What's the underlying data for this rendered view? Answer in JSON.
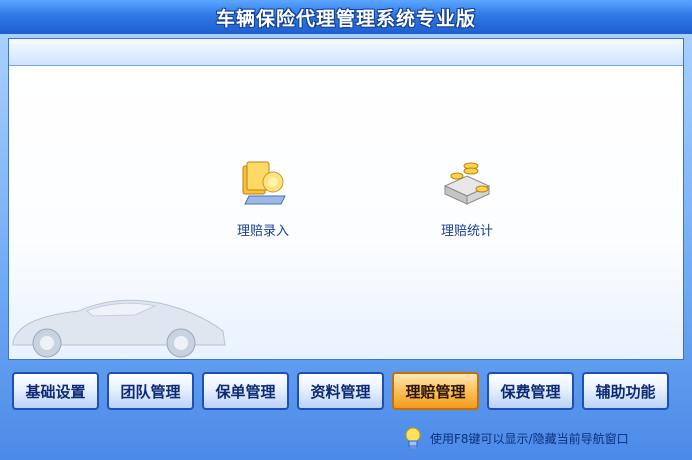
{
  "window": {
    "title": "车辆保险代理管理系统专业版"
  },
  "tools": [
    {
      "label": "理赔录入",
      "icon": "claim-entry-icon"
    },
    {
      "label": "理赔统计",
      "icon": "claim-stats-icon"
    }
  ],
  "nav": {
    "tabs": [
      {
        "label": "基础设置"
      },
      {
        "label": "团队管理"
      },
      {
        "label": "保单管理"
      },
      {
        "label": "资料管理"
      },
      {
        "label": "理赔管理",
        "active": true
      },
      {
        "label": "保费管理"
      },
      {
        "label": "辅助功能"
      }
    ]
  },
  "status": {
    "hint": "使用F8键可以显示/隐藏当前导航窗口",
    "icon": "lightbulb-icon"
  },
  "colors": {
    "accent": "#2f78e6",
    "active_tab": "#f09b1e"
  }
}
